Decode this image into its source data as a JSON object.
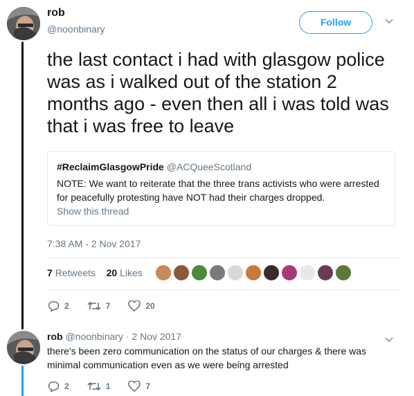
{
  "tweet": {
    "author_name": "rob",
    "author_handle": "@noonbinary",
    "follow_label": "Follow",
    "text": "the last contact i had with glasgow police was as i walked out of the station 2 months ago - even then all i was told was that i was free to leave",
    "quote": {
      "name": "#ReclaimGlasgowPride",
      "handle": "@ACQueeScotland",
      "text": "NOTE: We want to reiterate that the three trans activists who were arrested for peacefully protesting have NOT had their charges dropped.",
      "show_thread": "Show this thread"
    },
    "timestamp": "7:38 AM - 2 Nov 2017",
    "retweets_count": "7",
    "retweets_label": "Retweets",
    "likes_count": "20",
    "likes_label": "Likes",
    "liker_avatar_colors": [
      "#c98a5a",
      "#8a5a3a",
      "#4a8a3a",
      "#7a7a7a",
      "#d8d8d8",
      "#c87a3a",
      "#3a2a2a",
      "#a83a7a",
      "#e8e8e8",
      "#6a3a5a",
      "#5a7a3a"
    ],
    "actions": {
      "replies": "2",
      "retweets": "7",
      "likes": "20"
    }
  },
  "reply": {
    "author_name": "rob",
    "author_handle": "@noonbinary",
    "date": "· 2 Nov 2017",
    "text": "there's been zero communication on the status of our charges & there was minimal communication even as we were being arrested",
    "actions": {
      "replies": "2",
      "retweets": "1",
      "likes": "7"
    }
  },
  "colors": {
    "accent": "#1da1f2",
    "muted": "#657786"
  }
}
